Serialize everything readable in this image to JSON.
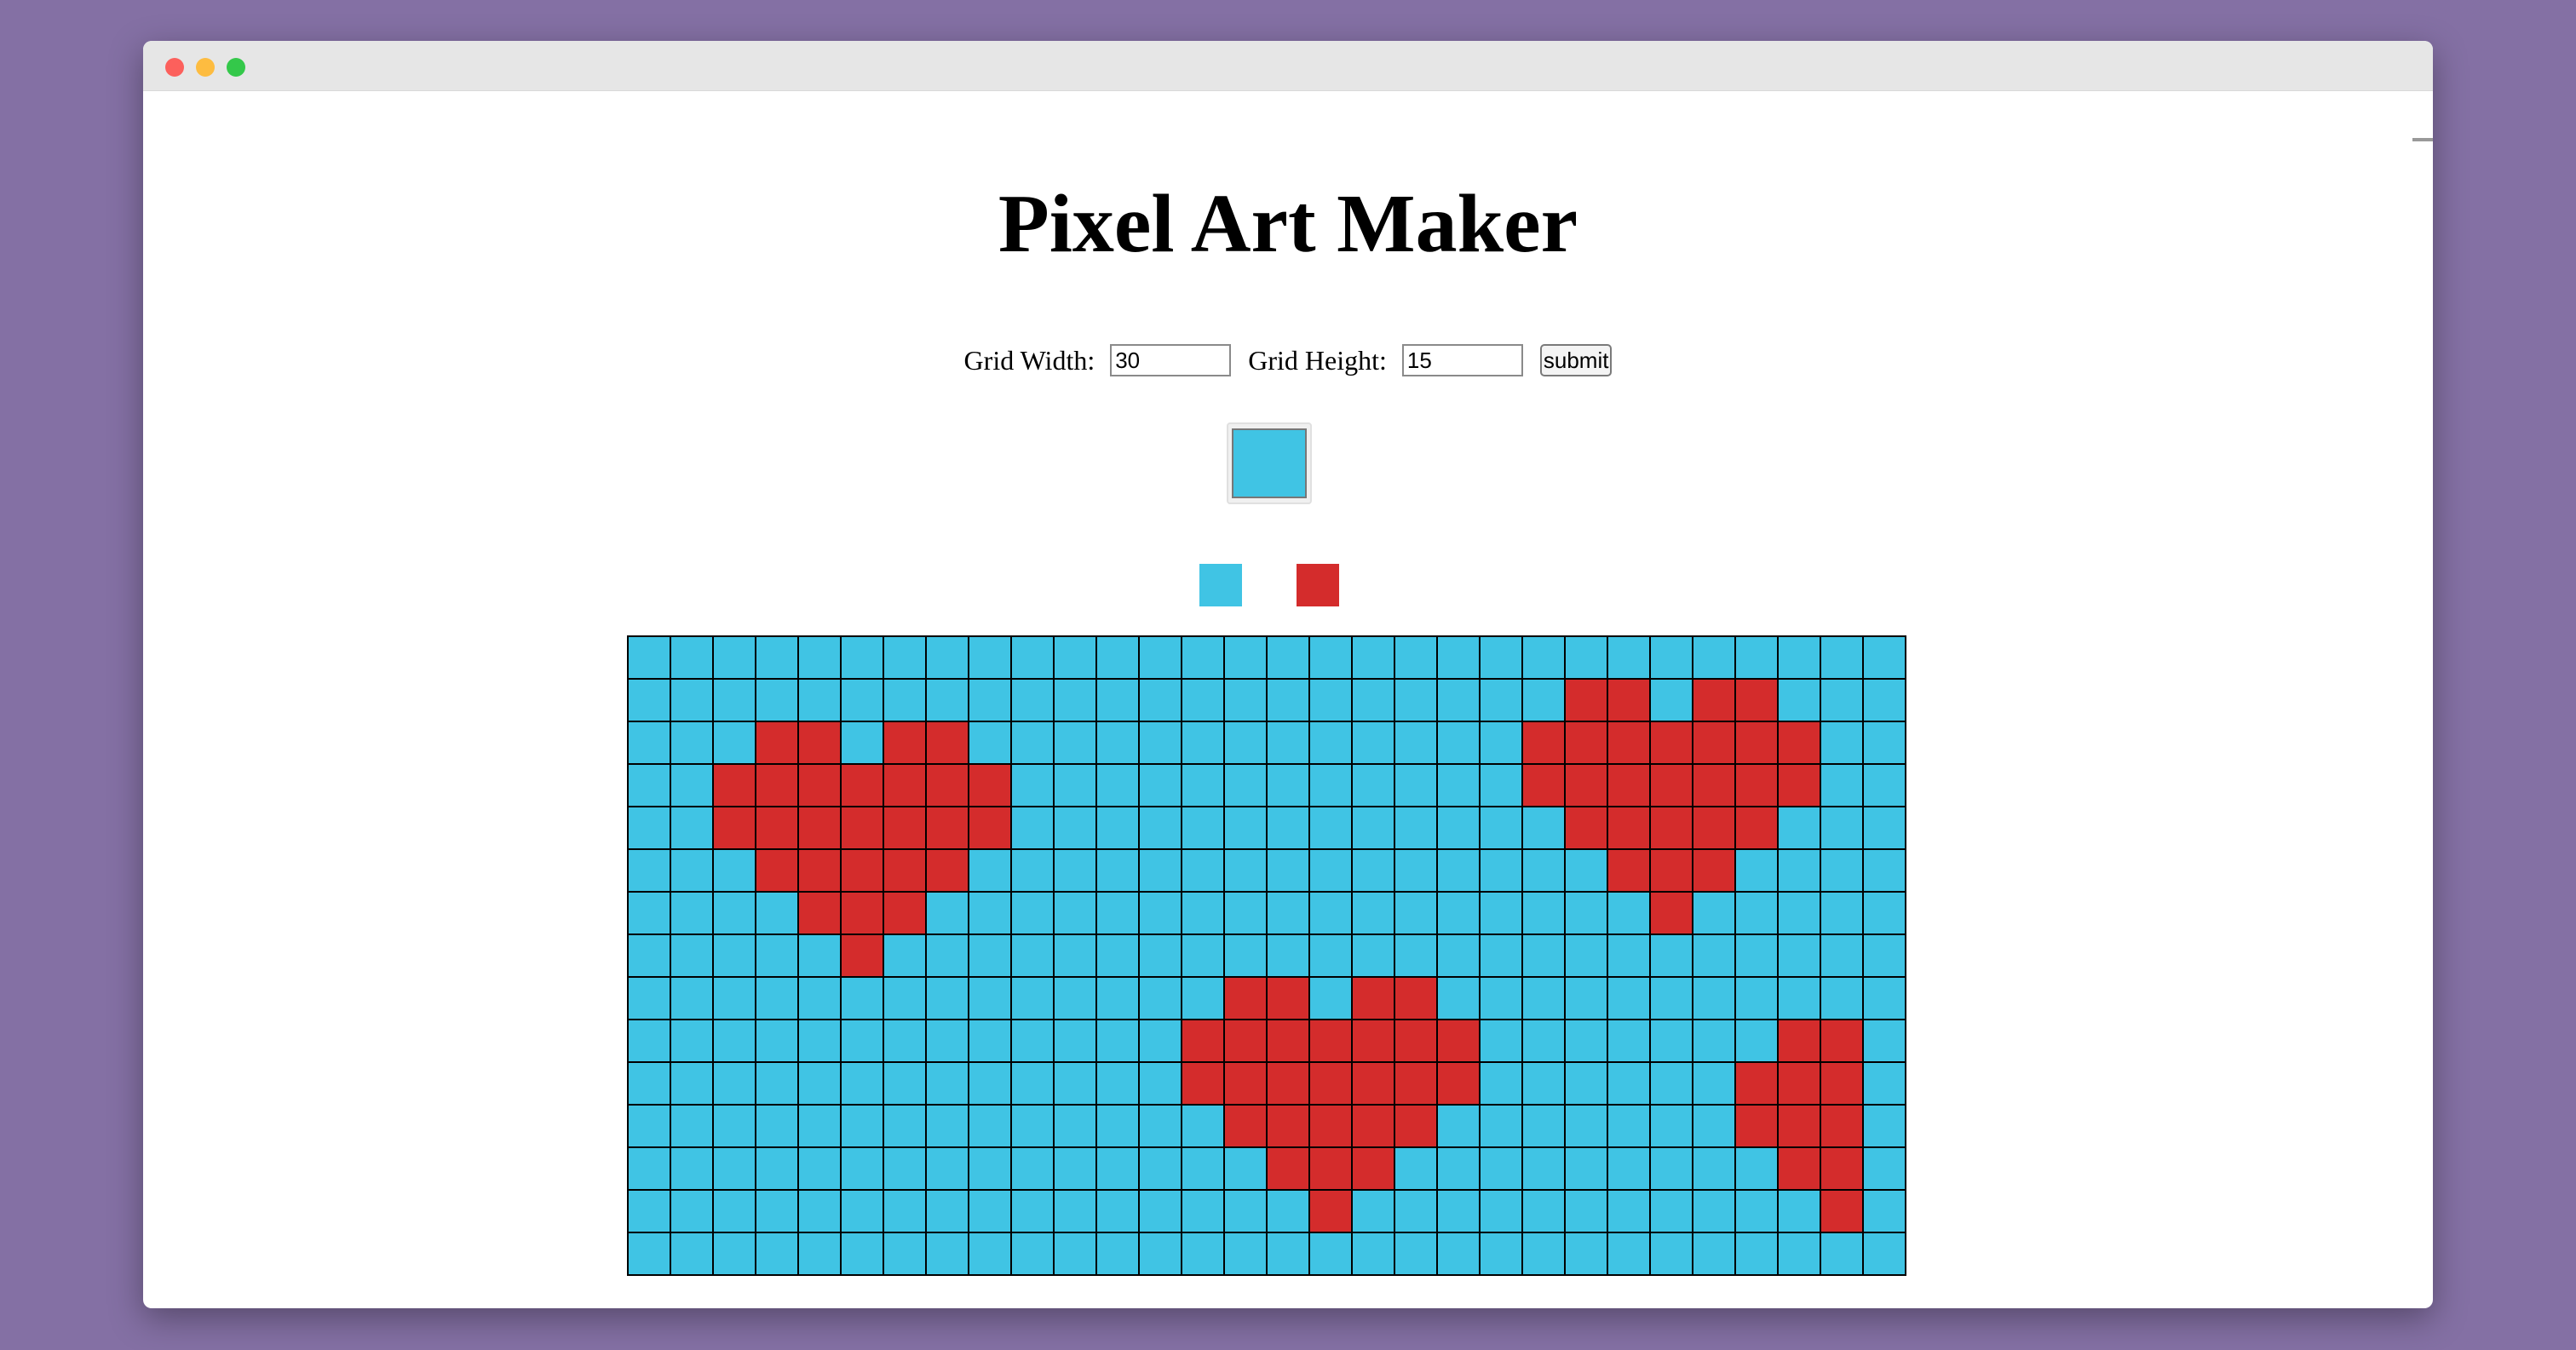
{
  "page": {
    "title": "Pixel Art Maker"
  },
  "form": {
    "width_label": "Grid Width:",
    "width_value": "30",
    "height_label": "Grid Height:",
    "height_value": "15",
    "submit_label": "submit"
  },
  "colors": {
    "background": "#8470a4",
    "blue": "#40c4e4",
    "red": "#d42c2c",
    "picker_value": "#40c4e4"
  },
  "palette": [
    {
      "name": "blue",
      "color": "#40c4e4"
    },
    {
      "name": "red",
      "color": "#d42c2c"
    }
  ],
  "grid": {
    "columns": 30,
    "rows": 15,
    "pixels": [
      "..............................",
      "......................RR.RR...",
      "...RR.RR.............RRRRRRR..",
      "..RRRRRRR............RRRRRRR..",
      "..RRRRRRR.............RRRRR...",
      "...RRRRR...............RRR....",
      "....RRR.................R.....",
      ".....R........................",
      "..............RR.RR...........",
      ".............RRRRRRR.......RR.",
      ".............RRRRRRR......RRR.",
      "..............RRRRR.......RRR.",
      "...............RRR.........RR.",
      "................R...........R.",
      ".............................."
    ]
  }
}
